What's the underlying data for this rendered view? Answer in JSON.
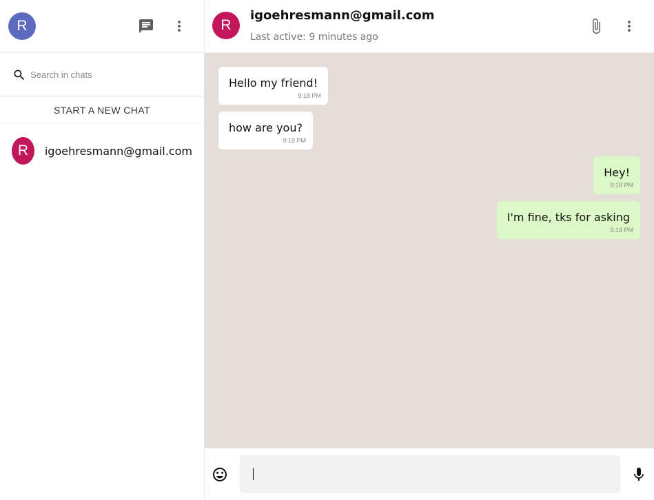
{
  "sidebar": {
    "user_avatar": {
      "letter": "R",
      "color": "#5c6bc0"
    },
    "icons": {
      "chat": "chat-icon",
      "menu": "more-vert-icon"
    },
    "search": {
      "placeholder": "Search in chats",
      "value": ""
    },
    "new_chat_label": "START A NEW CHAT",
    "chats": [
      {
        "name": "igoehresmann@gmail.com",
        "avatar_letter": "R",
        "avatar_color": "#c2185b"
      }
    ]
  },
  "header": {
    "avatar_letter": "R",
    "avatar_color": "#c2185b",
    "contact_name": "igoehresmann@gmail.com",
    "last_active": "Last active: 9 minutes ago",
    "icons": {
      "attach": "paperclip-icon",
      "menu": "more-vert-icon"
    }
  },
  "messages": [
    {
      "direction": "in",
      "text": "Hello my friend!",
      "time": "9:18 PM"
    },
    {
      "direction": "in",
      "text": "how are you?",
      "time": "9:18 PM"
    },
    {
      "direction": "out",
      "text": "Hey!",
      "time": "9:18 PM"
    },
    {
      "direction": "out",
      "text": "I'm fine, tks for asking",
      "time": "9:19 PM"
    }
  ],
  "composer": {
    "value": "",
    "icons": {
      "emoji": "emoji-icon",
      "mic": "microphone-icon"
    }
  },
  "colors": {
    "chat_background": "#e5ded8",
    "incoming_bubble": "#ffffff",
    "outgoing_bubble": "#dcf8c6"
  }
}
